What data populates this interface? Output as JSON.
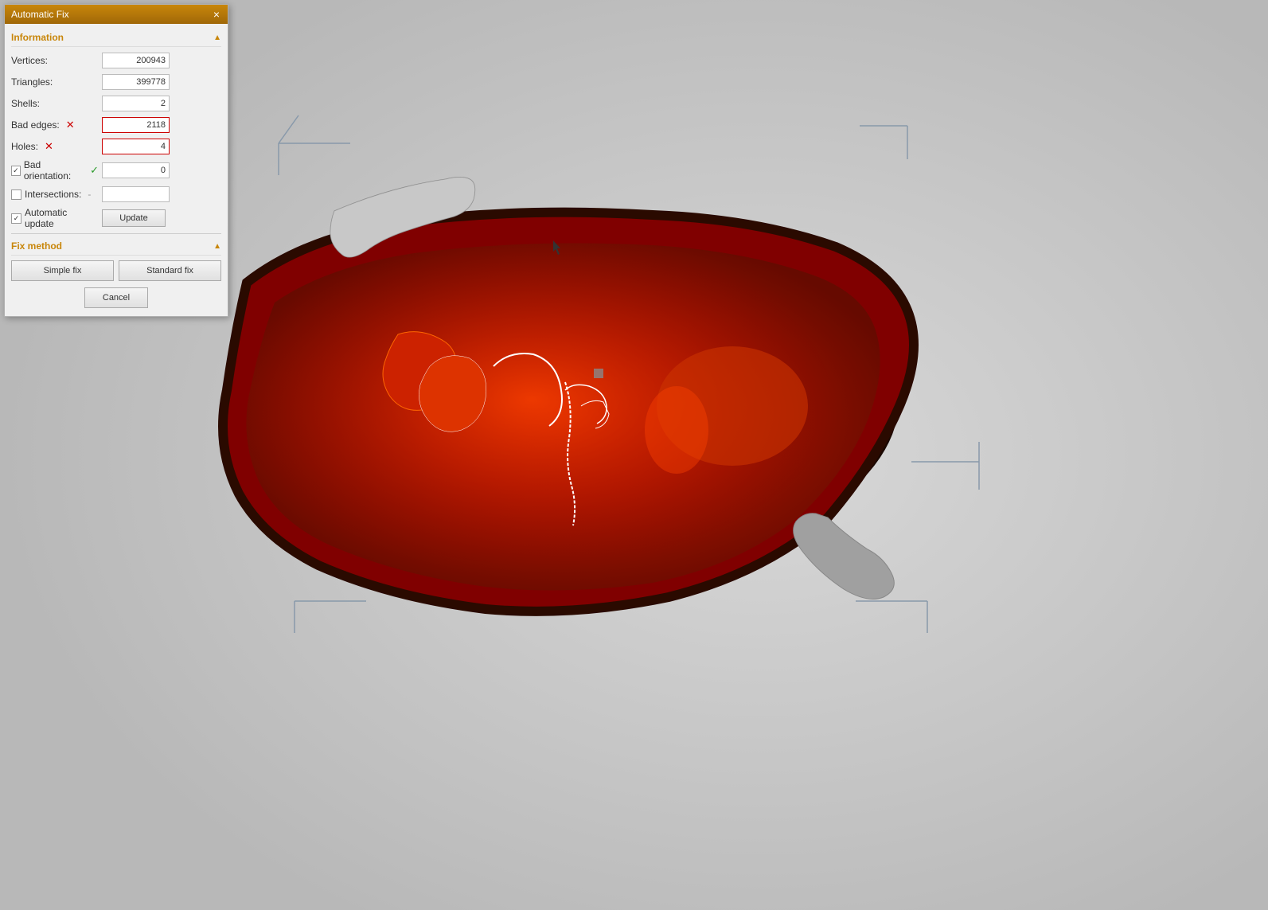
{
  "dialog": {
    "title": "Automatic Fix",
    "close_label": "×",
    "sections": {
      "information": {
        "label": "Information",
        "chevron": "▲",
        "fields": {
          "vertices": {
            "label": "Vertices:",
            "value": "200943"
          },
          "triangles": {
            "label": "Triangles:",
            "value": "399778"
          },
          "shells": {
            "label": "Shells:",
            "value": "2"
          },
          "bad_edges": {
            "label": "Bad edges:",
            "value": "2118",
            "status": "error"
          },
          "holes": {
            "label": "Holes:",
            "value": "4",
            "status": "error"
          },
          "bad_orientation": {
            "label": "Bad orientation:",
            "value": "0",
            "status": "ok",
            "has_checkbox": true
          },
          "intersections": {
            "label": "Intersections:",
            "value": "",
            "has_checkbox": true
          },
          "automatic_update": {
            "label": "Automatic update",
            "has_checkbox": true
          }
        },
        "update_btn": "Update"
      },
      "fix_method": {
        "label": "Fix method",
        "chevron": "▲",
        "simple_fix_label": "Simple fix",
        "standard_fix_label": "Standard fix"
      }
    },
    "cancel_label": "Cancel"
  },
  "viewport": {
    "background": "#c8c8c8"
  }
}
